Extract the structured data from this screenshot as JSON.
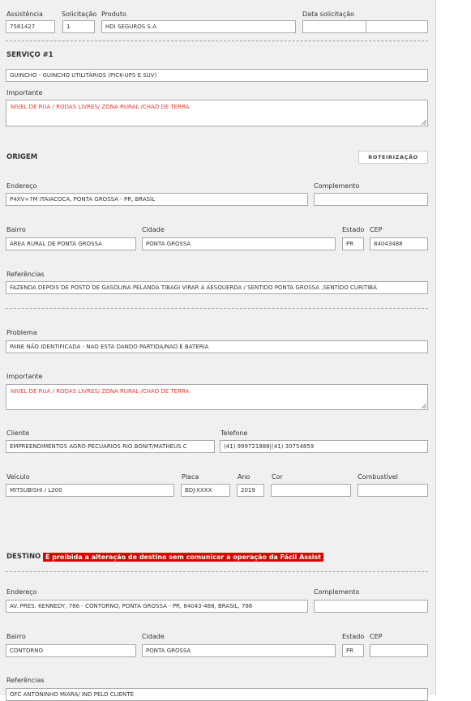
{
  "header": {
    "assistencia_label": "Assistência",
    "assistencia_value": "7581427",
    "solicitacao_label": "Solicitação",
    "solicitacao_value": "1",
    "produto_label": "Produto",
    "produto_value": "HDI SEGUROS S.A",
    "data_label": "Data solicitação",
    "data_value": "",
    "hora_value": ""
  },
  "servico": {
    "title": "SERVIÇO #1",
    "tipo_value": "GUINCHO - GUINCHO UTILITÁRIOS (PICK-UPS E SUV)",
    "importante_label": "Importante",
    "importante_value": "NIVEL DE RUA / RODAS LIVRES/ ZONA RURAL /CHAO DE TERRA"
  },
  "origem": {
    "title": "ORIGEM",
    "roteirizacao_label": "ROTEIRIZAÇÃO",
    "endereco_label": "Endereço",
    "endereco_value": "P4XV+7M ITAIACOCA, PONTA GROSSA - PR, BRASIL",
    "complemento_label": "Complemento",
    "complemento_value": "",
    "bairro_label": "Bairro",
    "bairro_value": "ÁREA RURAL DE PONTA GROSSA",
    "cidade_label": "Cidade",
    "cidade_value": "PONTA GROSSA",
    "estado_label": "Estado",
    "estado_value": "PR",
    "cep_label": "CEP",
    "cep_value": "84043488",
    "referencias_label": "Referências",
    "referencias_value": "FAZENDA DEPOIS DE POSTO DE GASOLINA PELANDA TIBAGI  VIRAR A AESQUERDA / SENTIDO PONTA GROSSA ,SENTIDO CURITIBA"
  },
  "problema": {
    "problema_label": "Problema",
    "problema_value": "PANE NÃO IDENTIFICADA - NAO ESTA DANDO PARTIDA/NAO É BATERIA",
    "importante_label": "Importante",
    "importante_value": "NIVEL DE RUA / RODAS LIVRES/ ZONA RURAL /CHAO DE TERRA",
    "cliente_label": "Cliente",
    "cliente_value": "EMPREENDIMENTOS AGRO-PECUARIOS RIO BONIT/MATHEUS C",
    "telefone_label": "Telefone",
    "telefone_value": "(41) 999721888|(41) 30754859",
    "veiculo_label": "Veículo",
    "veiculo_value": "MITSUBISHI / L200",
    "placa_label": "Placa",
    "placa_value": "BDJ-XXXX",
    "ano_label": "Ano",
    "ano_value": "2019",
    "cor_label": "Cor",
    "cor_value": "",
    "combustivel_label": "Combustível",
    "combustivel_value": ""
  },
  "destino": {
    "title": "DESTINO",
    "warning": "É proibida a alteração de destino sem comunicar a operação da Fácil Assist",
    "endereco_label": "Endereço",
    "endereco_value": "AV. PRES. KENNEDY, 786 - CONTORNO, PONTA GROSSA - PR, 84043-488, BRASIL, 786",
    "complemento_label": "Complemento",
    "complemento_value": "",
    "bairro_label": "Bairro",
    "bairro_value": "CONTORNO",
    "cidade_label": "Cidade",
    "cidade_value": "PONTA GROSSA",
    "estado_label": "Estado",
    "estado_value": "PR",
    "cep_label": "CEP",
    "cep_value": "",
    "referencias_label": "Referências",
    "referencias_value": "OFC ANTONINHO MIARA/ IND PELO CLIENTE"
  },
  "icons": {
    "resize": "resize-grip-icon"
  }
}
